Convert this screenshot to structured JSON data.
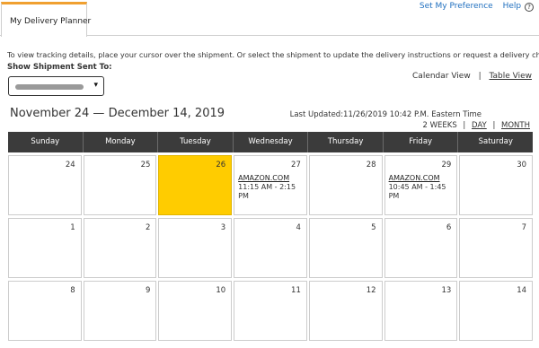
{
  "tab": {
    "label": "My Delivery Planner"
  },
  "toplinks": {
    "preference": "Set My Preference",
    "help": "Help",
    "help_icon": "?"
  },
  "instructions": "To view tracking details, place your cursor over the shipment. Or select the shipment to update the delivery instructions or request a delivery change.",
  "show_label": "Show Shipment Sent To:",
  "select": {
    "arrow": "▾"
  },
  "view_links": {
    "calendar": "Calendar View",
    "separator": "|",
    "table": "Table View"
  },
  "date_range": "November 24 — December 14, 2019",
  "last_updated": "Last Updated:11/26/2019 10:42 P.M. Eastern Time",
  "range_views": {
    "two_weeks": "2 WEEKS",
    "separator": "|",
    "day": "DAY",
    "month": "MONTH"
  },
  "calendar": {
    "headers": [
      "Sunday",
      "Monday",
      "Tuesday",
      "Wednesday",
      "Thursday",
      "Friday",
      "Saturday"
    ],
    "weeks": [
      [
        {
          "num": "24"
        },
        {
          "num": "25"
        },
        {
          "num": "26",
          "today": true
        },
        {
          "num": "27",
          "event": {
            "carrier": "AMAZON.COM",
            "time": "11:15 AM - 2:15 PM"
          }
        },
        {
          "num": "28"
        },
        {
          "num": "29",
          "event": {
            "carrier": "AMAZON.COM",
            "time": "10:45 AM - 1:45 PM"
          }
        },
        {
          "num": "30"
        }
      ],
      [
        {
          "num": "1"
        },
        {
          "num": "2"
        },
        {
          "num": "3"
        },
        {
          "num": "4"
        },
        {
          "num": "5"
        },
        {
          "num": "6"
        },
        {
          "num": "7"
        }
      ],
      [
        {
          "num": "8"
        },
        {
          "num": "9"
        },
        {
          "num": "10"
        },
        {
          "num": "11"
        },
        {
          "num": "12"
        },
        {
          "num": "13"
        },
        {
          "num": "14"
        }
      ]
    ]
  },
  "colors": {
    "accent_tab": "#f0a030",
    "today": "#ffcc00",
    "header_bg": "#3b3b3b",
    "link": "#1f6fbf"
  }
}
